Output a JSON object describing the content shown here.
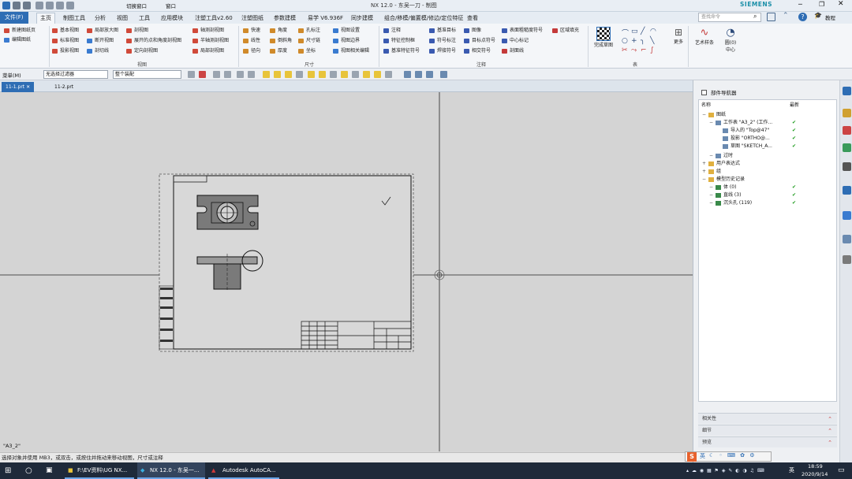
{
  "window": {
    "title": "NX 12.0 - 东吴一刀 - 制图",
    "brand": "SIEMENS",
    "switch_window": "切换窗口",
    "window_menu": "窗口"
  },
  "menu_tabs": [
    "文件(F)",
    "主页",
    "制图工具",
    "分析",
    "视图",
    "工具",
    "应用模块",
    "注塑工具v2.60",
    "注塑图纸",
    "参数建模",
    "易学 V6.936F",
    "同步建模",
    "组合/移模/偏置模/修边/定位特征",
    "查看"
  ],
  "search_placeholder": "查找命令",
  "ribbon": {
    "col1": [
      "新建图纸页",
      "编辑图纸"
    ],
    "view_items": [
      "基本视图",
      "标准视图",
      "投影视图",
      "局部放大图",
      "断开视图",
      "剖切线",
      "剖视图",
      "展开的点和角度剖视图",
      "定向剖视图",
      "轴测剖视图",
      "半轴测剖视图",
      "局部剖视图"
    ],
    "dim_items": [
      "快速",
      "线性",
      "径向",
      "角度",
      "倒斜角",
      "厚度",
      "孔标注",
      "尺寸链",
      "坐标",
      "视图设置",
      "视图相关编辑",
      "视图边界"
    ],
    "note_items": [
      "注释",
      "特征控制框",
      "基准特征符号",
      "基准目标",
      "符号标注",
      "焊接符号",
      "图像",
      "目标点符号",
      "相交符号",
      "表面粗糙度符号",
      "中心标记",
      "剖面线",
      "区域填充"
    ],
    "group_labels": [
      "视图",
      "尺寸",
      "注释",
      "表"
    ],
    "big_buttons": [
      "完成草图",
      "更多",
      "艺术样条",
      "圆(0)",
      "中心"
    ]
  },
  "toolbar": {
    "menu_label": "菜单(M)",
    "filter_select": "无选择过滤器",
    "scope_select": "整个装配"
  },
  "doc_tabs": [
    "11-1.prt",
    "11-2.prt"
  ],
  "canvas": {
    "sheet_label": "\"A3_2\""
  },
  "status_text": "选择对象并使用 MB3，或双击，或按住并拖动来移动视图，尺寸或注释",
  "navigator": {
    "title": "部件导航器",
    "col_name": "名称",
    "col_latest": "最新",
    "rows": [
      {
        "label": "图纸",
        "indent": 0,
        "check": ""
      },
      {
        "label": "工作表 \"A3_2\" (工作...",
        "indent": 1,
        "check": "✔"
      },
      {
        "label": "导入的 \"Top@47\"",
        "indent": 2,
        "check": "✔"
      },
      {
        "label": "投影 \"ORTHO@...",
        "indent": 2,
        "check": "✔"
      },
      {
        "label": "草图 \"SKETCH_A...",
        "indent": 2,
        "check": "✔"
      },
      {
        "label": "过时",
        "indent": 1,
        "check": ""
      },
      {
        "label": "用户表达式",
        "indent": 0,
        "check": ""
      },
      {
        "label": "组",
        "indent": 0,
        "check": ""
      },
      {
        "label": "模型历史记录",
        "indent": 0,
        "check": ""
      },
      {
        "label": "体 (0)",
        "indent": 1,
        "check": "✔"
      },
      {
        "label": "直线 (3)",
        "indent": 1,
        "check": "✔"
      },
      {
        "label": "沉头孔 (119)",
        "indent": 1,
        "check": "✔"
      }
    ],
    "sections": [
      "相关性",
      "细节",
      "预览"
    ]
  },
  "taskbar": {
    "apps": [
      "F:\\EV资料\\UG NX...",
      "NX 12.0 - 东吴一...",
      "Autodesk AutoCA..."
    ],
    "ime": "英",
    "time": "18:59",
    "date": "2020/9/14"
  }
}
